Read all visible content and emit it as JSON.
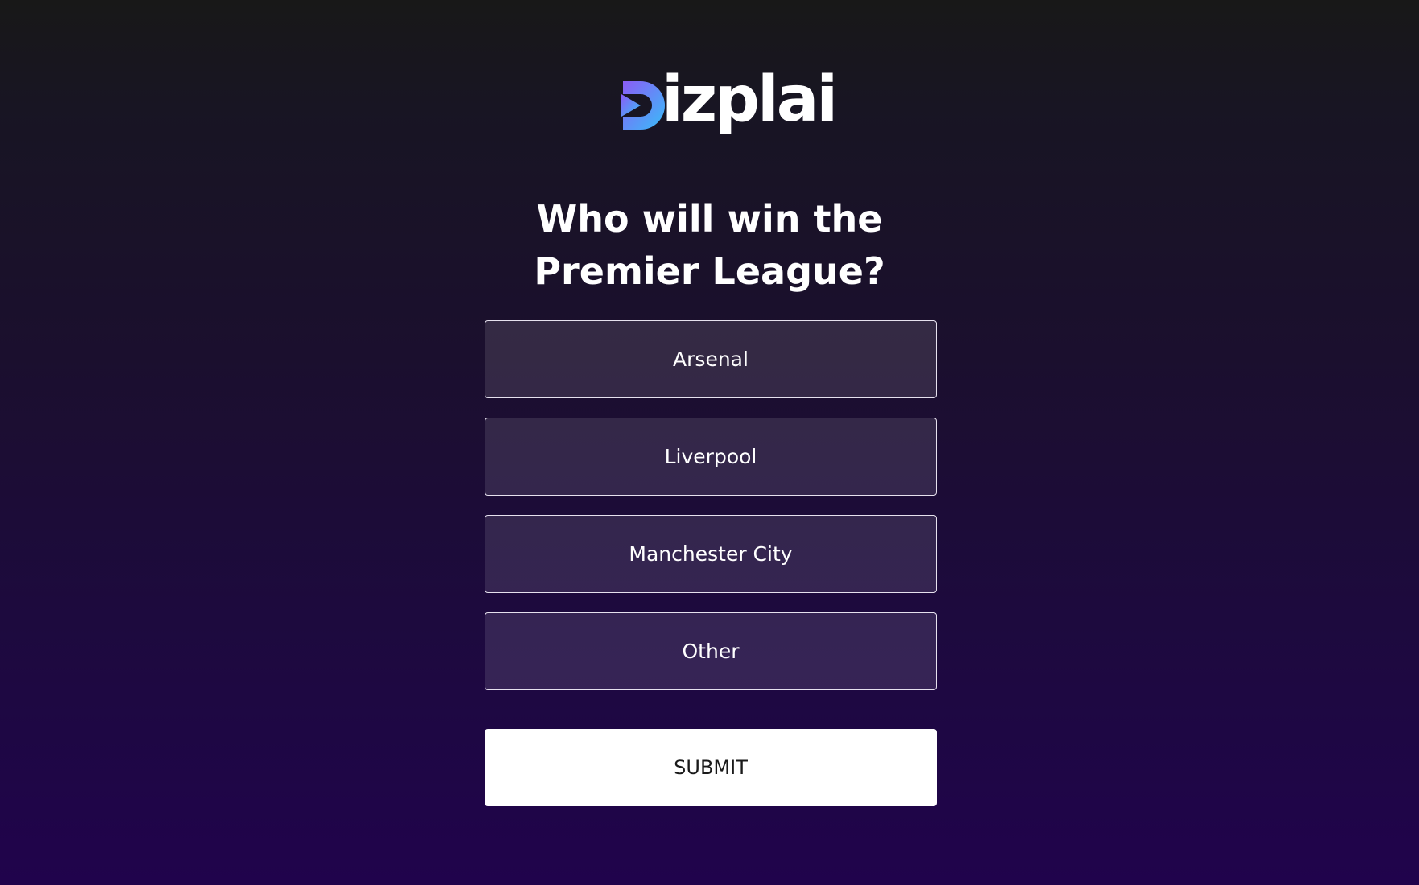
{
  "brand": {
    "name": "izplai",
    "full_name": "Dizplai",
    "logo_icon": "play-d-logo-icon",
    "gradient_colors": [
      "#8b5cf6",
      "#38bdf8"
    ]
  },
  "poll": {
    "question_line1": "Who will win the",
    "question_line2": "Premier League?",
    "options": [
      {
        "label": "Arsenal"
      },
      {
        "label": "Liverpool"
      },
      {
        "label": "Manchester City"
      },
      {
        "label": "Other"
      }
    ],
    "submit_label": "SUBMIT"
  },
  "colors": {
    "background_top": "#181818",
    "background_bottom": "#20034c",
    "option_border": "#e6e1ee",
    "submit_background": "#ffffff",
    "submit_text": "#1a1a1a"
  }
}
